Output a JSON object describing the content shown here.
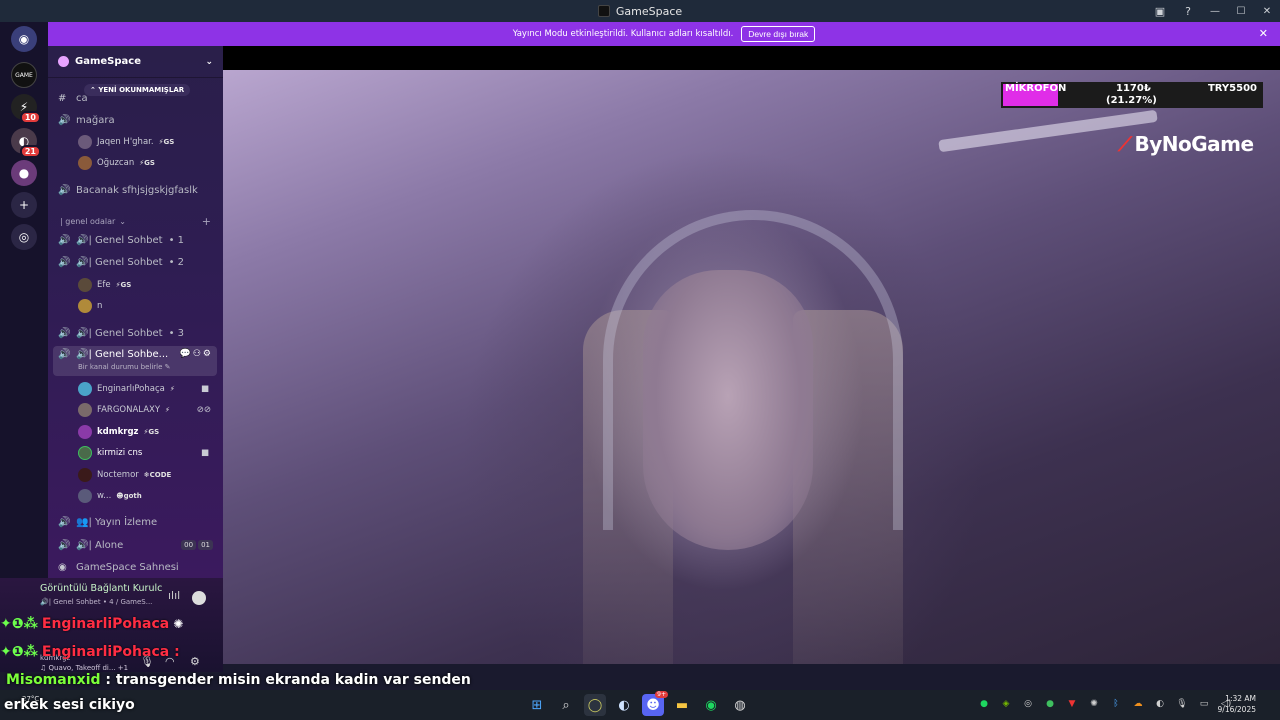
{
  "window": {
    "title": "GameSpace"
  },
  "banner": {
    "message": "Yayıncı Modu etkinleştirildi. Kullanıcı adları kısaltıldı.",
    "button": "Devre dışı bırak"
  },
  "servers": [
    {
      "name": "discord-home",
      "badge": ""
    },
    {
      "name": "gamespace",
      "badge": ""
    },
    {
      "name": "server-2",
      "badge": "10"
    },
    {
      "name": "server-3",
      "badge": "21"
    },
    {
      "name": "server-4",
      "badge": ""
    }
  ],
  "guild": {
    "name": "GameSpace",
    "new_unread": "YENİ OKUNMAMIŞLAR"
  },
  "channels": {
    "partial_top": "ca",
    "magara": "mağara",
    "magara_users": [
      {
        "name": "Jaqen H'ghar.",
        "tag": "GS"
      },
      {
        "name": "Oğuzcan",
        "tag": "GS"
      }
    ],
    "bacanak": "Bacanak sfhjsjgskjgfaslk",
    "category": "| genel odalar",
    "genel1": "🔊| Genel Sohbet",
    "genel1_count": "• 1",
    "genel2": "🔊| Genel Sohbet",
    "genel2_count": "• 2",
    "genel2_users": [
      {
        "name": "Efe",
        "tag": "GS"
      },
      {
        "name": "n",
        "tag": ""
      }
    ],
    "genel3": "🔊| Genel Sohbet",
    "genel3_count": "• 3",
    "genel4": "🔊| Genel Sohbe...",
    "genel4_status": "Bir kanal durumu belirle",
    "genel4_users": [
      {
        "name": "EnginarlıPohaça",
        "tag": ""
      },
      {
        "name": "FARGONALAXY",
        "tag": ""
      },
      {
        "name": "kdmkrgz",
        "tag": "GS"
      },
      {
        "name": "kirmizi cns",
        "tag": ""
      },
      {
        "name": "Noctemor",
        "tag": "CODE"
      },
      {
        "name": "w...",
        "tag": "goth"
      }
    ],
    "yayin": "👥| Yayın İzleme",
    "alone": "🔊| Alone",
    "alone_counter": [
      "00",
      "01"
    ],
    "stage": "GameSpace Sahnesi"
  },
  "voice": {
    "status": "Görüntülü Bağlantı Kurulc",
    "channel": "🔊| Genel Sohbet • 4 / GameS...",
    "now_playing": "♫ Quavo, Takeoff di... +1",
    "user_partial": "kdmkrgz"
  },
  "overlay": {
    "chat1_user": "EnginarliPohaca",
    "chat2_user": "EnginarliPohaca :",
    "mic_label": "MİKROFON",
    "mic_amount": "1170₺",
    "mic_percent": "(21.27%)",
    "mic_goal": "TRY5500",
    "mic_fraction": 0.2127,
    "brand": "ByNoGame",
    "caption_user": "Misomanxid",
    "caption_text": ": transgender misin ekranda kadin var senden",
    "caption_line2": "erkek sesi cikiyo"
  },
  "taskbar": {
    "weather": "27°C",
    "time": "1:32 AM",
    "date": "9/16/2025",
    "discord_badge": "9+"
  },
  "colors": {
    "banner": "#8e33e6",
    "mic_fill": "#e02de8",
    "chat_red": "#ff2d43",
    "nick_green": "#7cff3a"
  }
}
